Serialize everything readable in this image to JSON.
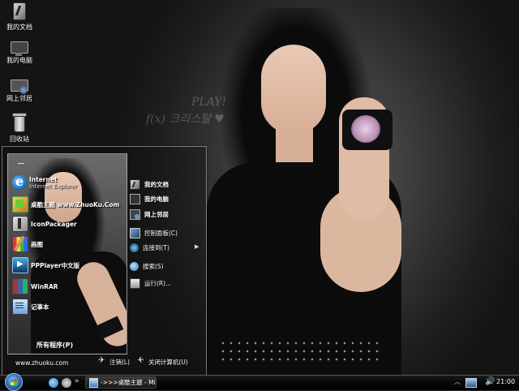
{
  "desktop": {
    "icons": [
      {
        "label": "我的文档",
        "icon": "documents-icon"
      },
      {
        "label": "我的电脑",
        "icon": "computer-icon"
      },
      {
        "label": "网上邻居",
        "icon": "network-icon"
      },
      {
        "label": "回收站",
        "icon": "recycle-bin-icon"
      }
    ],
    "wallpaper_text": {
      "line1": "PLAY!",
      "line2": "f(x) 크리스탈 ♥"
    }
  },
  "start_menu": {
    "programs": [
      {
        "title": "Internet",
        "subtitle": "Internet Explorer",
        "icon": "internet-explorer-icon"
      },
      {
        "title": "桌酷主题 www.ZhuoKu.Com",
        "icon": "theme-icon"
      },
      {
        "title": "IconPackager",
        "icon": "iconpackager-icon"
      },
      {
        "title": "画图",
        "icon": "paint-icon"
      },
      {
        "title": "PPPlayer中文版",
        "icon": "player-icon"
      },
      {
        "title": "WinRAR",
        "icon": "winrar-icon"
      },
      {
        "title": "记事本",
        "icon": "notepad-icon"
      }
    ],
    "all_programs": "所有程序(P)",
    "places": [
      {
        "label": "我的文档",
        "icon": "documents-icon",
        "bold": true
      },
      {
        "label": "我的电脑",
        "icon": "computer-icon",
        "bold": true
      },
      {
        "label": "网上邻居",
        "icon": "network-icon",
        "bold": true
      },
      {
        "label": "控制面板(C)",
        "icon": "control-panel-icon",
        "bold": false
      },
      {
        "label": "连接到(T)",
        "icon": "connect-icon",
        "bold": false,
        "submenu": "▶"
      },
      {
        "label": "搜索(S)",
        "icon": "search-icon",
        "bold": false
      },
      {
        "label": "运行(R)...",
        "icon": "run-icon",
        "bold": false
      }
    ],
    "footer": {
      "url": "www.zhuoku.com",
      "logoff": "注销(L)",
      "shutdown": "关闭计算机(U)"
    }
  },
  "taskbar": {
    "chevron": "»",
    "task": {
      "label": "->>>桌酷主题 - Mi..."
    },
    "tray_chevron": "︿",
    "volume": "🔊",
    "clock": "21:00"
  },
  "colors": {
    "taskbar_bg": "#0a0a0a",
    "start_orb": "#2c78c4",
    "menu_border": "#c8c8c8"
  }
}
